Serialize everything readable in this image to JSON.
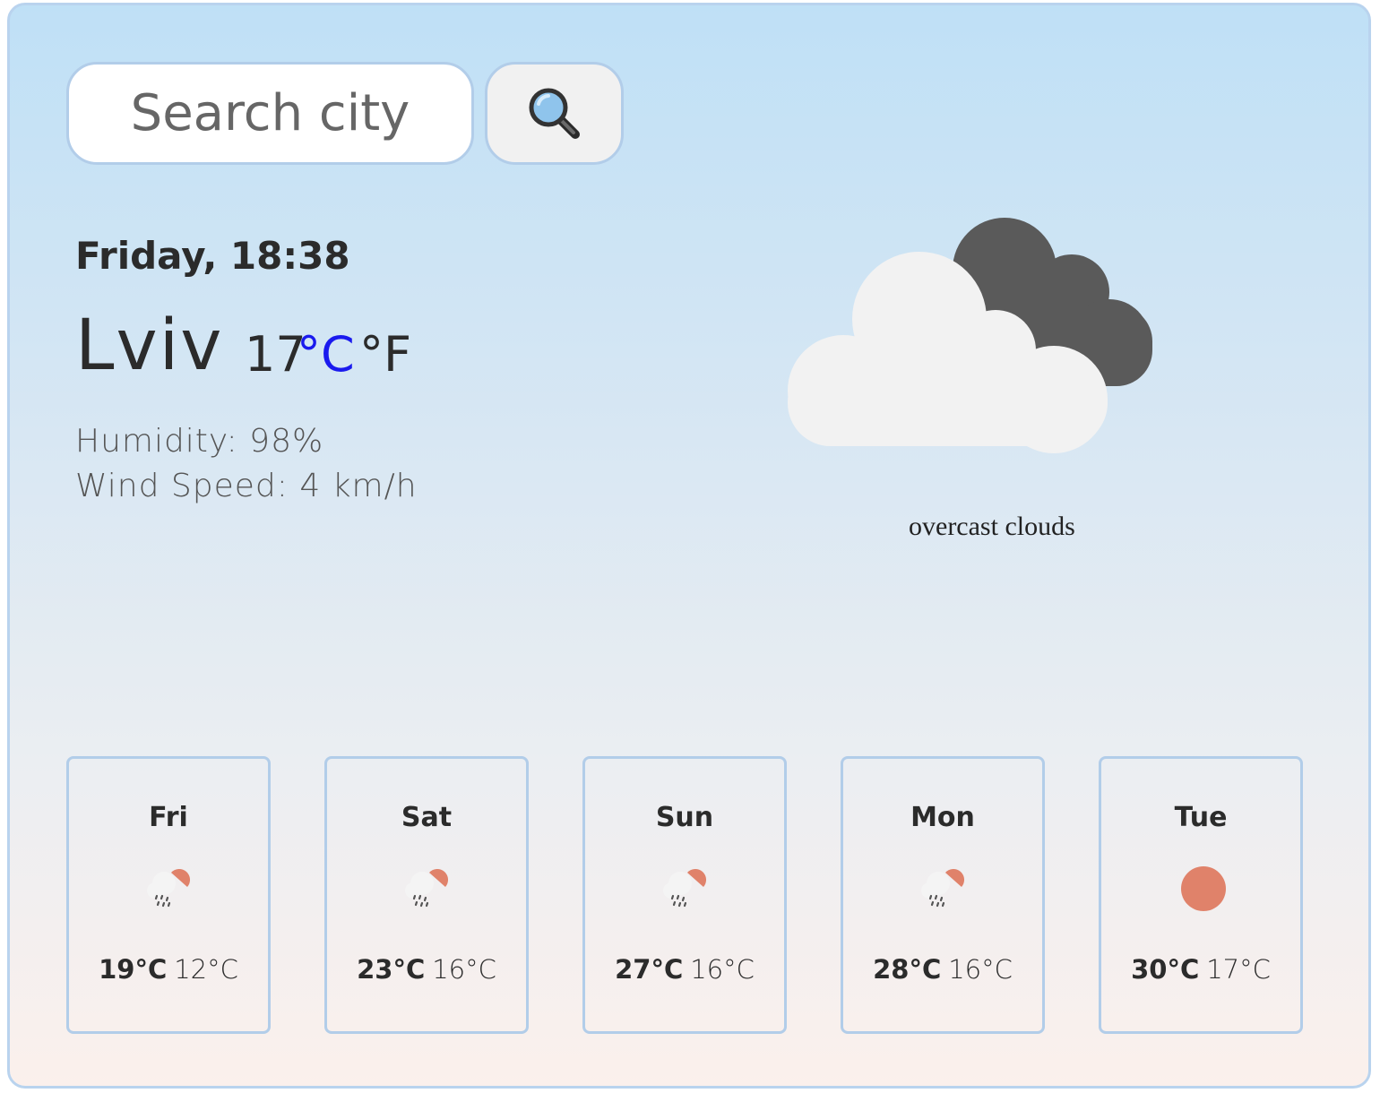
{
  "search": {
    "placeholder": "Search city",
    "button_icon": "magnifier-icon"
  },
  "current": {
    "date": "Friday, 18:38",
    "city": "Lviv",
    "temperature": "17",
    "unit_celsius": "°C",
    "unit_fahrenheit": "°F",
    "humidity": "Humidity:  98%",
    "wind": "Wind Speed: 4 km/h",
    "description": "overcast clouds",
    "icon": "overcast-clouds-icon"
  },
  "forecast": [
    {
      "day": "Fri",
      "max": "19°C",
      "min": "12°C",
      "icon": "rain-sun-icon"
    },
    {
      "day": "Sat",
      "max": "23°C",
      "min": "16°C",
      "icon": "rain-sun-icon"
    },
    {
      "day": "Sun",
      "max": "27°C",
      "min": "16°C",
      "icon": "rain-sun-icon"
    },
    {
      "day": "Mon",
      "max": "28°C",
      "min": "16°C",
      "icon": "rain-sun-icon"
    },
    {
      "day": "Tue",
      "max": "30°C",
      "min": "17°C",
      "icon": "sun-icon"
    }
  ],
  "colors": {
    "accent_unit": "#1a1aee",
    "border": "#b2cde9",
    "sun": "#e0826a",
    "dark_cloud": "#5a5a5a",
    "light_cloud": "#f2f2f2"
  }
}
